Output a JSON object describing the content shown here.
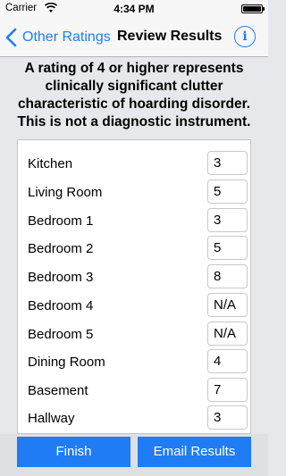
{
  "status_bar": {
    "carrier": "Carrier",
    "time": "4:34 PM",
    "battery_level": 1.0
  },
  "nav": {
    "back_label": "Other Ratings",
    "title": "Review Results",
    "info_label": "i",
    "accent": "#1f7cf5"
  },
  "disclaimer": {
    "lines": [
      "A rating of 4 or higher represents",
      "clinically significant clutter",
      "characteristic of hoarding disorder.",
      "This is not a diagnostic instrument."
    ]
  },
  "results": [
    {
      "room": "Kitchen",
      "rating": "3"
    },
    {
      "room": "Living Room",
      "rating": "5"
    },
    {
      "room": "Bedroom 1",
      "rating": "3"
    },
    {
      "room": "Bedroom 2",
      "rating": "5"
    },
    {
      "room": "Bedroom 3",
      "rating": "8"
    },
    {
      "room": "Bedroom 4",
      "rating": "N/A"
    },
    {
      "room": "Bedroom 5",
      "rating": "N/A"
    },
    {
      "room": "Dining Room",
      "rating": "4"
    },
    {
      "room": "Basement",
      "rating": "7"
    },
    {
      "room": "Hallway",
      "rating": "3"
    }
  ],
  "footer": {
    "finish_label": "Finish",
    "email_label": "Email Results"
  }
}
